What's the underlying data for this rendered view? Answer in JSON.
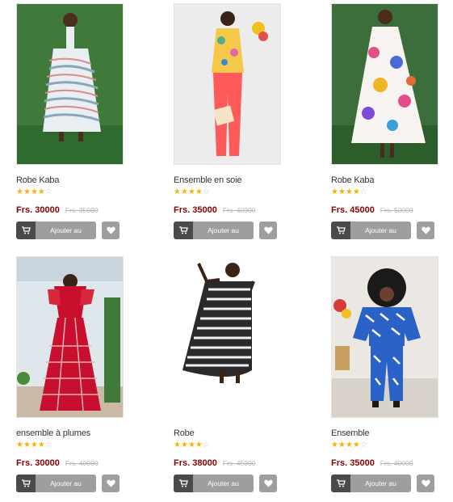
{
  "products": [
    {
      "name": "Robe Kaba",
      "rating": 4,
      "max_rating": 5,
      "price": "Frs. 30000",
      "old_price": "Frs. 35000",
      "add_to_cart": "Ajouter au panier"
    },
    {
      "name": "Ensemble en soie",
      "rating": 4,
      "max_rating": 5,
      "price": "Frs. 35000",
      "old_price": "Frs. 40000",
      "add_to_cart": "Ajouter au panier"
    },
    {
      "name": "Robe Kaba",
      "rating": 4,
      "max_rating": 5,
      "price": "Frs. 45000",
      "old_price": "Frs. 50000",
      "add_to_cart": "Ajouter au panier"
    },
    {
      "name": "ensemble à plumes",
      "rating": 4,
      "max_rating": 5,
      "price": "Frs. 30000",
      "old_price": "Frs. 40000",
      "add_to_cart": "Ajouter au panier"
    },
    {
      "name": "Robe",
      "rating": 4,
      "max_rating": 5,
      "price": "Frs. 38000",
      "old_price": "Frs. 45000",
      "add_to_cart": "Ajouter au panier"
    },
    {
      "name": "Ensemble",
      "rating": 4,
      "max_rating": 5,
      "price": "Frs. 35000",
      "old_price": "Frs. 40000",
      "add_to_cart": "Ajouter au panier"
    }
  ],
  "icons": {
    "cart": "shopping-cart-icon",
    "wishlist": "heart-icon",
    "star_filled": "star-filled-icon",
    "star_empty": "star-empty-icon"
  },
  "colors": {
    "price": "#8b0000",
    "old_price": "#b5b5b5",
    "star": "#f5b20c",
    "button_dark": "#4a4a4a",
    "button_gray": "#9e9e9e"
  }
}
